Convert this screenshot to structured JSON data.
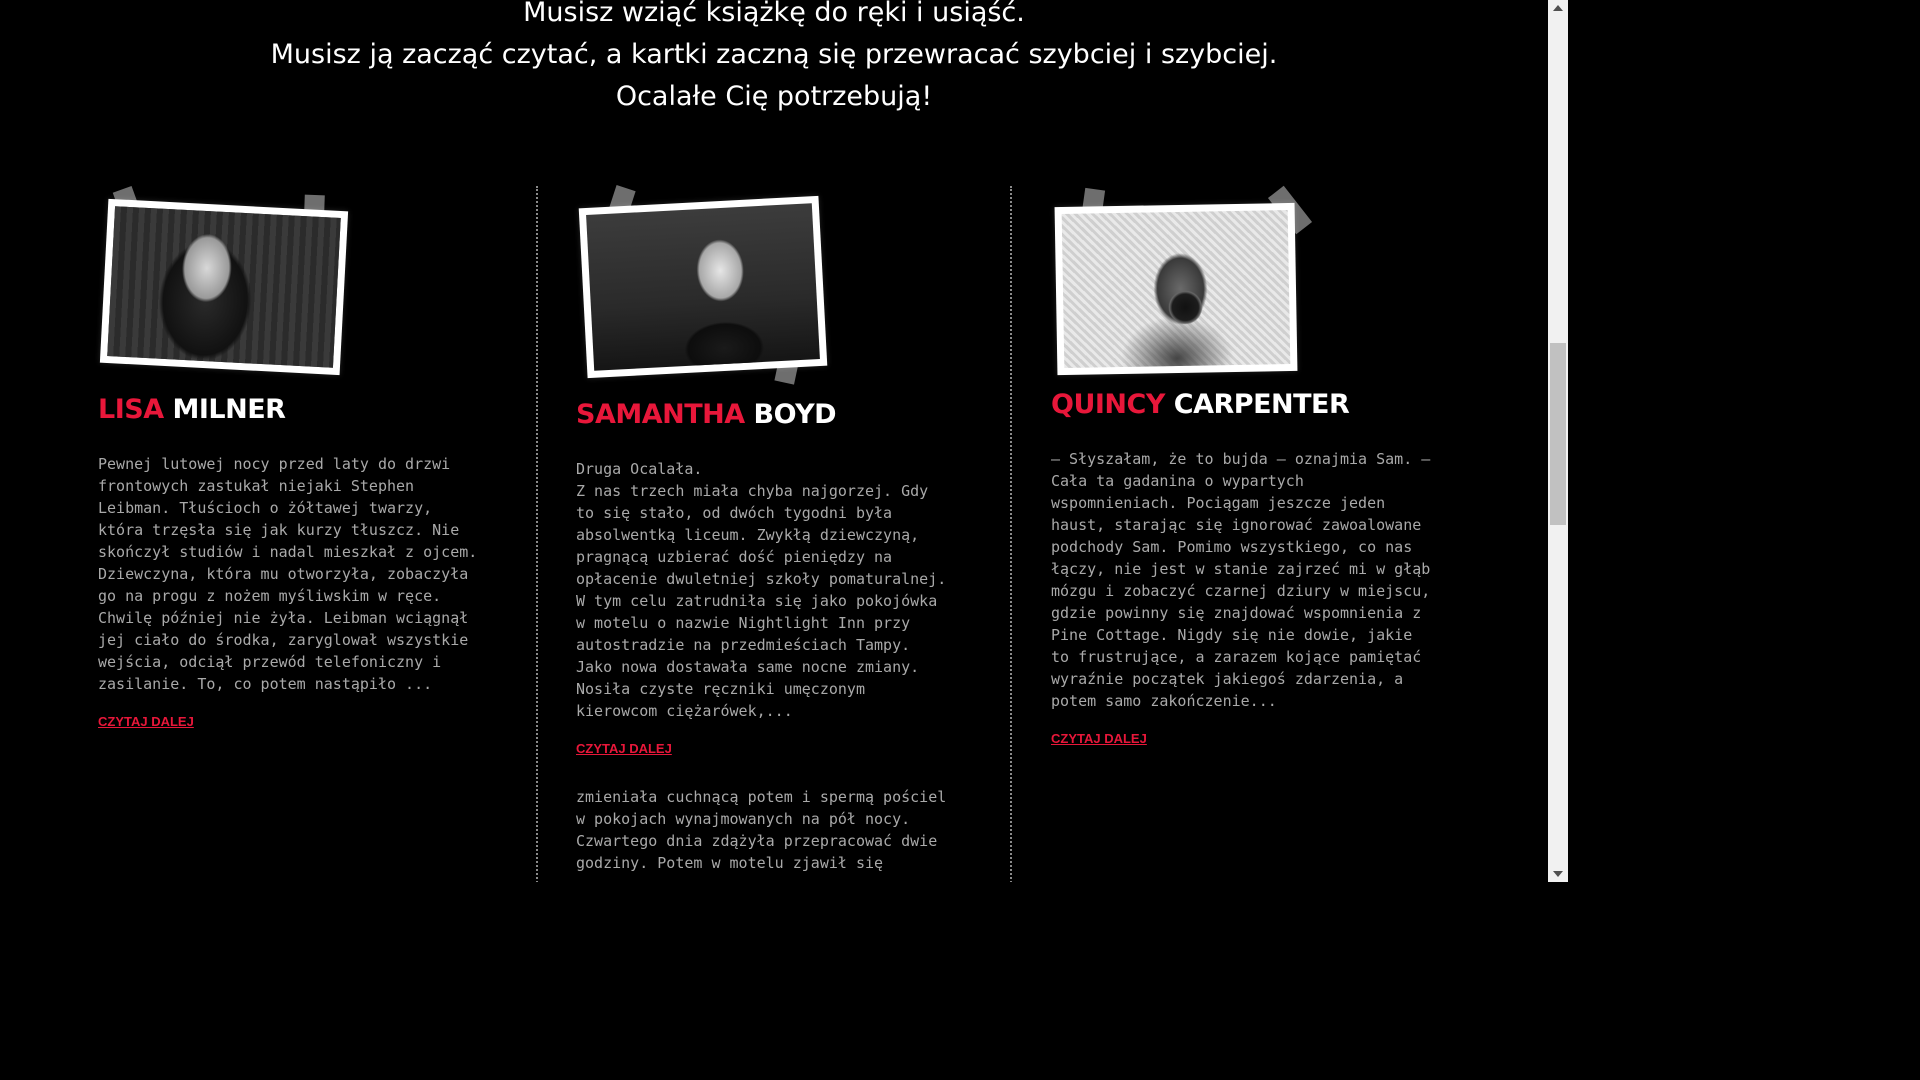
{
  "intro": {
    "lines": [
      "Musisz wziąć książkę do ręki i usiąść.",
      "Musisz ją zacząć czytać, a kartki zaczną się przewracać szybciej i szybciej.",
      "Ocalałe Cię potrzebują!"
    ]
  },
  "characters": [
    {
      "first_name": "LISA",
      "last_name": "MILNER",
      "photo_icon": "portrait-photo",
      "text": "Pewnej lutowej nocy przed laty do drzwi\nfrontowych zastukał niejaki Stephen\nLeibman. Tłuścioch o żółtawej twarzy,\nktóra trzęsła się jak kurzy tłuszcz. Nie\nskończył studiów i nadal mieszkał z ojcem.\nDziewczyna, która mu otworzyła, zobaczyła\ngo na progu z nożem myśliwskim w ręce.\nChwilę później nie żyła. Leibman wciągnął\njej ciało do środka, zaryglował wszystkie\nwejścia, odciął przewód telefoniczny i\nzasilanie. To, co potem nastąpiło ...",
      "more_label": "CZYTAJ DALEJ"
    },
    {
      "first_name": "SAMANTHA",
      "last_name": "BOYD",
      "photo_icon": "portrait-photo",
      "text": "Druga Ocalała.\nZ nas trzech miała chyba najgorzej. Gdy\nto się stało, od dwóch tygodni była\nabsolwentką liceum. Zwykłą dziewczyną,\npragnącą uzbierać dość pieniędzy na\nopłacenie dwuletniej szkoły pomaturalnej.\nW tym celu zatrudniła się jako pokojówka\nw motelu o nazwie Nightlight Inn przy\nautostradzie na przedmieściach Tampy.\nJako nowa dostawała same nocne zmiany.\nNosiła czyste ręczniki umęczonym\nkierowcom ciężarówek,...",
      "more_label": "CZYTAJ DALEJ",
      "extra_text": "zmieniała cuchnącą potem i spermą pościel\nw pokojach wynajmowanych na pół nocy.\nCzwartego dnia zdążyła przepracować dwie\ngodziny. Potem w motelu zjawił się"
    },
    {
      "first_name": "QUINCY",
      "last_name": "CARPENTER",
      "photo_icon": "portrait-photo",
      "text": "– Słyszałam, że to bujda – oznajmia Sam. –\nCała ta gadanina o wypartych\nwspomnieniach. Pociągam jeszcze jeden\nhaust, starając się ignorować zawoalowane\npodchody Sam. Pomimo wszystkiego, co nas\nłączy, nie jest w stanie zajrzeć mi w głąb\nmózgu i zobaczyć czarnej dziury w miejscu,\ngdzie powinny się znajdować wspomnienia z\nPine Cottage. Nigdy się nie dowie, jakie\nto frustrujące, a zarazem kojące pamiętać\nwyraźnie początek jakiegoś zdarzenia, a\npotem samo zakończenie...",
      "more_label": "CZYTAJ DALEJ"
    }
  ],
  "colors": {
    "accent": "#e8173a",
    "background": "#000000",
    "body_text": "#a9a9a9"
  }
}
